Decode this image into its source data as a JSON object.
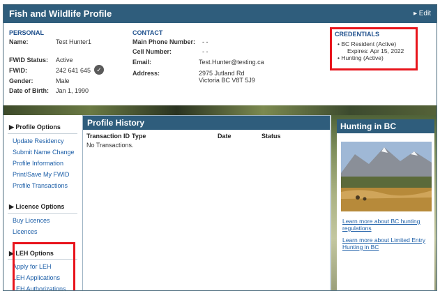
{
  "window": {
    "title": "Fish and Wildlife Profile",
    "edit_label": "▸ Edit"
  },
  "personal": {
    "heading": "PERSONAL",
    "name_label": "Name:",
    "name_value": "Test Hunter1",
    "fwid_status_label": "FWID Status:",
    "fwid_status_value": "Active",
    "fwid_label": "FWID:",
    "fwid_value": "242 641 645",
    "gender_label": "Gender:",
    "gender_value": "Male",
    "dob_label": "Date of Birth:",
    "dob_value": "Jan 1, 1990"
  },
  "contact": {
    "heading": "CONTACT",
    "main_phone_label": "Main Phone Number:",
    "main_phone_value": "- -",
    "cell_label": "Cell Number:",
    "cell_value": "- -",
    "email_label": "Email:",
    "email_value": "Test.Hunter@testing.ca",
    "address_label": "Address:",
    "address_line1": "2975 Jutland Rd",
    "address_line2": "Victoria BC V8T 5J9"
  },
  "credentials": {
    "heading": "CREDENTIALS",
    "item1": "BC Resident (Active)",
    "item1_sub": "Expires: Apr 15, 2022",
    "item2": "Hunting (Active)"
  },
  "sidebar": {
    "profile_options": {
      "heading": "Profile Options",
      "links": [
        "Update Residency",
        "Submit Name Change",
        "Profile Information",
        "Print/Save My FWID",
        "Profile Transactions"
      ]
    },
    "licence_options": {
      "heading": "Licence Options",
      "links": [
        "Buy Licences",
        "Licences"
      ]
    },
    "leh_options": {
      "heading": "LEH Options",
      "links": [
        "Apply for LEH",
        "LEH Applications",
        "LEH Authorizations"
      ]
    }
  },
  "history": {
    "title": "Profile History",
    "columns": [
      "Transaction ID",
      "Type",
      "Date",
      "Status"
    ],
    "empty_text": "No Transactions."
  },
  "hunting": {
    "title": "Hunting in BC",
    "link1": "Learn more about BC hunting regulations",
    "link2": "Learn more about Limited Entry Hunting in BC"
  },
  "colors": {
    "header": "#2f5d7c",
    "link": "#1d5fa8",
    "highlight": "#e8141c"
  }
}
